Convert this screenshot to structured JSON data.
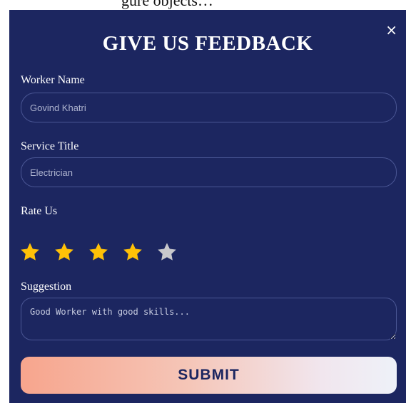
{
  "modal": {
    "title": "GIVE US FEEDBACK",
    "close_symbol": "×"
  },
  "form": {
    "worker_name": {
      "label": "Worker Name",
      "placeholder": "Govind Khatri"
    },
    "service_title": {
      "label": "Service Title",
      "placeholder": "Electrician"
    },
    "rating": {
      "label": "Rate Us",
      "value": 4,
      "max": 5,
      "filled_color": "#ffc107",
      "empty_color": "#c8c8cc"
    },
    "suggestion": {
      "label": "Suggestion",
      "placeholder": "Good Worker with good skills..."
    },
    "submit_label": "SUBMIT"
  },
  "colors": {
    "background": "#1c2660",
    "border": "#4a5694",
    "text": "#ffffff"
  }
}
